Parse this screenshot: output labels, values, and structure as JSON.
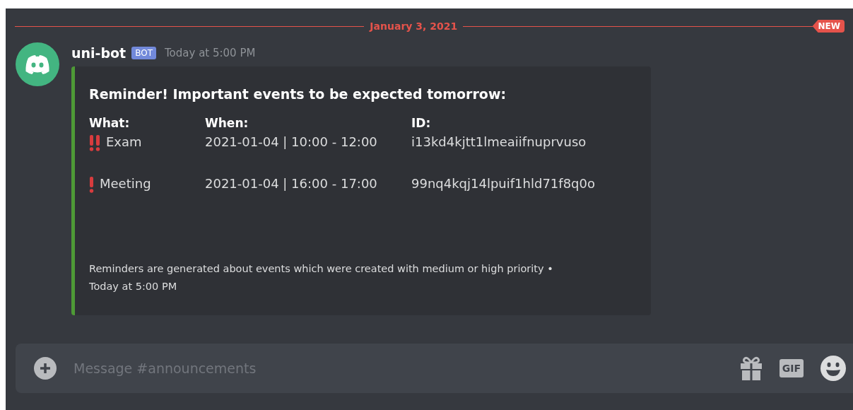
{
  "divider": {
    "date": "January 3, 2021",
    "badge": "NEW"
  },
  "message": {
    "author": "uni-bot",
    "tag": "BOT",
    "timestamp": "Today at 5:00 PM",
    "embed": {
      "color": "#4e9a36",
      "title": "Reminder! Important events to be expected tomorrow:",
      "columns": [
        "What:",
        "When:",
        "ID:"
      ],
      "rows": [
        {
          "kind": "high",
          "what": "Exam",
          "when": "2021-01-04 | 10:00 - 12:00",
          "id": "i13kd4kjtt1lmeaiifnuprvuso"
        },
        {
          "kind": "medium",
          "what": "Meeting",
          "when": "2021-01-04 | 16:00 - 17:00",
          "id": "99nq4kqj14lpuif1hld71f8q0o"
        }
      ],
      "footer": "Reminders are generated about events which were created with medium or high priority •",
      "footer_time": "Today at 5:00 PM"
    }
  },
  "composer": {
    "placeholder": "Message #announcements",
    "gif_label": "GIF"
  }
}
